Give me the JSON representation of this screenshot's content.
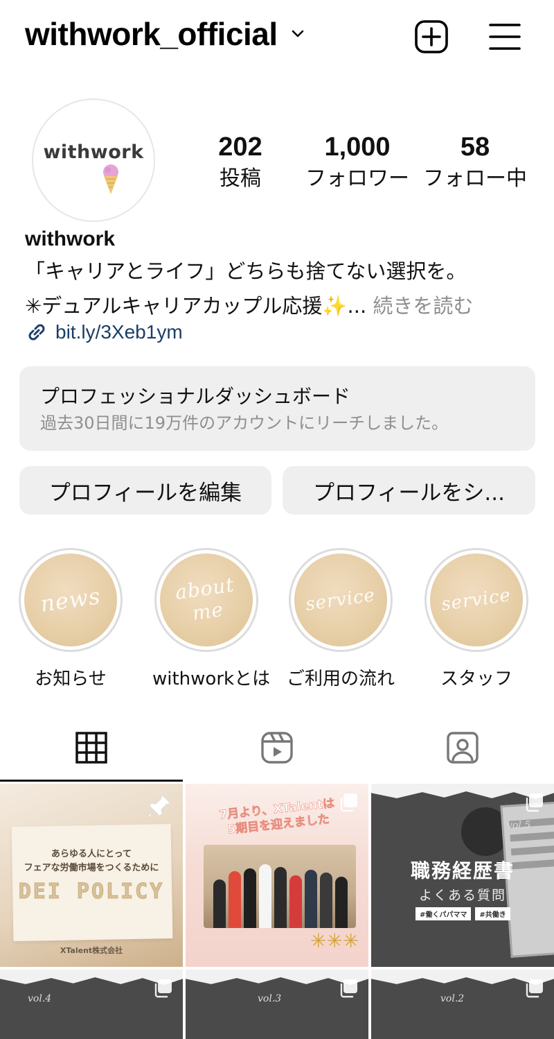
{
  "header": {
    "username": "withwork_official",
    "icons": [
      "chevron-down-icon",
      "plus-square-icon",
      "menu-icon"
    ]
  },
  "profile": {
    "avatar_text": "withwork",
    "stats": [
      {
        "num": "202",
        "label": "投稿"
      },
      {
        "num": "1,000",
        "label": "フォロワー"
      },
      {
        "num": "58",
        "label": "フォロー中"
      }
    ],
    "name": "withwork",
    "bio_line1": "「キャリアとライフ」どちらも捨てない選択を。",
    "bio_line2": "✳デュアルキャリアカップル応援✨...",
    "bio_more": " 続きを読む",
    "link": "bit.ly/3Xeb1ym"
  },
  "dashboard": {
    "title": "プロフェッショナルダッシュボード",
    "subtitle": "過去30日間に19万件のアカウントにリーチしました。"
  },
  "buttons": {
    "edit": "プロフィールを編集",
    "share": "プロフィールをシ..."
  },
  "highlights": [
    {
      "cover": "news",
      "label": "お知らせ"
    },
    {
      "cover": "about me",
      "label": "withworkとは"
    },
    {
      "cover": "service",
      "label": "ご利用の流れ"
    },
    {
      "cover": "service",
      "label": "スタッフ"
    }
  ],
  "tabs": [
    "grid-icon",
    "reels-icon",
    "tagged-icon"
  ],
  "posts": {
    "p1": {
      "small1": "あらゆる人にとって",
      "small2": "フェアな労働市場をつくるために",
      "big": "DEI POLICY",
      "company": "XTalent株式会社"
    },
    "p2": {
      "line1": "7月より、XTalentは",
      "line2": "5期目を迎えました"
    },
    "p3": {
      "vol": "vol.5",
      "title": "職務経歴書",
      "sub": "よくある質問",
      "tag1": "#働くパパママ",
      "tag2": "#共働き"
    },
    "p4": {
      "vol": "vol.4"
    },
    "p5": {
      "vol": "vol.3"
    },
    "p6": {
      "vol": "vol.2"
    }
  },
  "colors": {
    "link": "#1b3e66",
    "muted": "#8e8e8e",
    "button_bg": "#efefef",
    "highlight_cover": "#e7cfa8"
  }
}
